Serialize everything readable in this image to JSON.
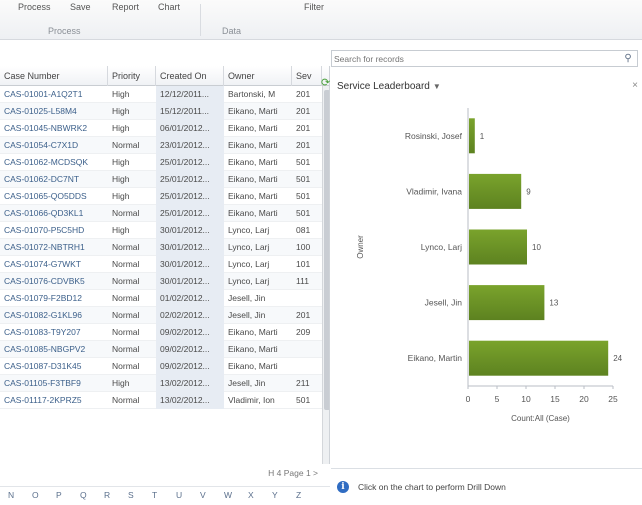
{
  "ribbon": {
    "top_items": [
      "Process",
      "Save",
      "Report",
      "Chart",
      "Filter"
    ],
    "groups": [
      "Process",
      "Data"
    ]
  },
  "grid": {
    "columns": [
      "Case Number",
      "Priority",
      "Created On",
      "Owner",
      "Sev"
    ],
    "rows": [
      [
        "CAS-01001-A1Q2T1",
        "High",
        "12/12/2011...",
        "Bartonski, M",
        "201"
      ],
      [
        "CAS-01025-L58M4",
        "High",
        "15/12/2011...",
        "Eikano, Marti",
        "201"
      ],
      [
        "CAS-01045-NBWRK2",
        "High",
        "06/01/2012...",
        "Eikano, Marti",
        "201"
      ],
      [
        "CAS-01054-C7X1D",
        "Normal",
        "23/01/2012...",
        "Eikano, Marti",
        "201"
      ],
      [
        "CAS-01062-MCDSQK",
        "High",
        "25/01/2012...",
        "Eikano, Marti",
        "501"
      ],
      [
        "CAS-01062-DC7NT",
        "High",
        "25/01/2012...",
        "Eikano, Marti",
        "501"
      ],
      [
        "CAS-01065-QO5DDS",
        "High",
        "25/01/2012...",
        "Eikano, Marti",
        "501"
      ],
      [
        "CAS-01066-QD3KL1",
        "Normal",
        "25/01/2012...",
        "Eikano, Marti",
        "501"
      ],
      [
        "CAS-01070-P5C5HD",
        "High",
        "30/01/2012...",
        "Lynco, Larj",
        "081"
      ],
      [
        "CAS-01072-NBTRH1",
        "Normal",
        "30/01/2012...",
        "Lynco, Larj",
        "100"
      ],
      [
        "CAS-01074-G7WKT",
        "Normal",
        "30/01/2012...",
        "Lynco, Larj",
        "101"
      ],
      [
        "CAS-01076-CDVBK5",
        "Normal",
        "30/01/2012...",
        "Lynco, Larj",
        "111"
      ],
      [
        "CAS-01079-F2BD12",
        "Normal",
        "01/02/2012...",
        "Jesell, Jin",
        ""
      ],
      [
        "CAS-01082-G1KL96",
        "Normal",
        "02/02/2012...",
        "Jesell, Jin",
        "201"
      ],
      [
        "CAS-01083-T9Y207",
        "Normal",
        "09/02/2012...",
        "Eikano, Marti",
        "209"
      ],
      [
        "CAS-01085-NBGPV2",
        "Normal",
        "09/02/2012...",
        "Eikano, Marti",
        ""
      ],
      [
        "CAS-01087-D31K45",
        "Normal",
        "09/02/2012...",
        "Eikano, Marti",
        ""
      ],
      [
        "CAS-01105-F3TBF9",
        "High",
        "13/02/2012...",
        "Jesell, Jin",
        "211"
      ],
      [
        "CAS-01117-2KPRZ5",
        "Normal",
        "13/02/2012...",
        "Vladimir, Ion",
        "501"
      ]
    ]
  },
  "pager": "H 4 Page 1 >",
  "alphabet": [
    "N",
    "O",
    "P",
    "Q",
    "R",
    "S",
    "T",
    "U",
    "V",
    "W",
    "X",
    "Y",
    "Z"
  ],
  "search": {
    "placeholder": "Search for records"
  },
  "pane": {
    "chart_title": "Service Leaderboard",
    "drill_text": "Click on the chart to perform Drill Down"
  },
  "colors": {
    "bar": "#7aa32c",
    "bar_dark": "#5d8220",
    "link": "#3b5f8a",
    "info": "#2f6cc2"
  },
  "icons": {
    "search": "search-icon",
    "refresh": "refresh-icon",
    "info": "info-icon",
    "close": "close-icon"
  },
  "chart_data": {
    "type": "bar",
    "orientation": "horizontal",
    "categories": [
      "Rosinski, Josef",
      "Vladimir, Ivana",
      "Lynco, Larj",
      "Jesell, Jin",
      "Eikano, Martin"
    ],
    "values": [
      1,
      9,
      10,
      13,
      24
    ],
    "ylabel": "Owner",
    "xlabel": "Count:All (Case)",
    "xlim": [
      0,
      25
    ],
    "xticks": [
      0,
      5,
      10,
      15,
      20,
      25
    ],
    "grid": false,
    "legend": "none"
  }
}
